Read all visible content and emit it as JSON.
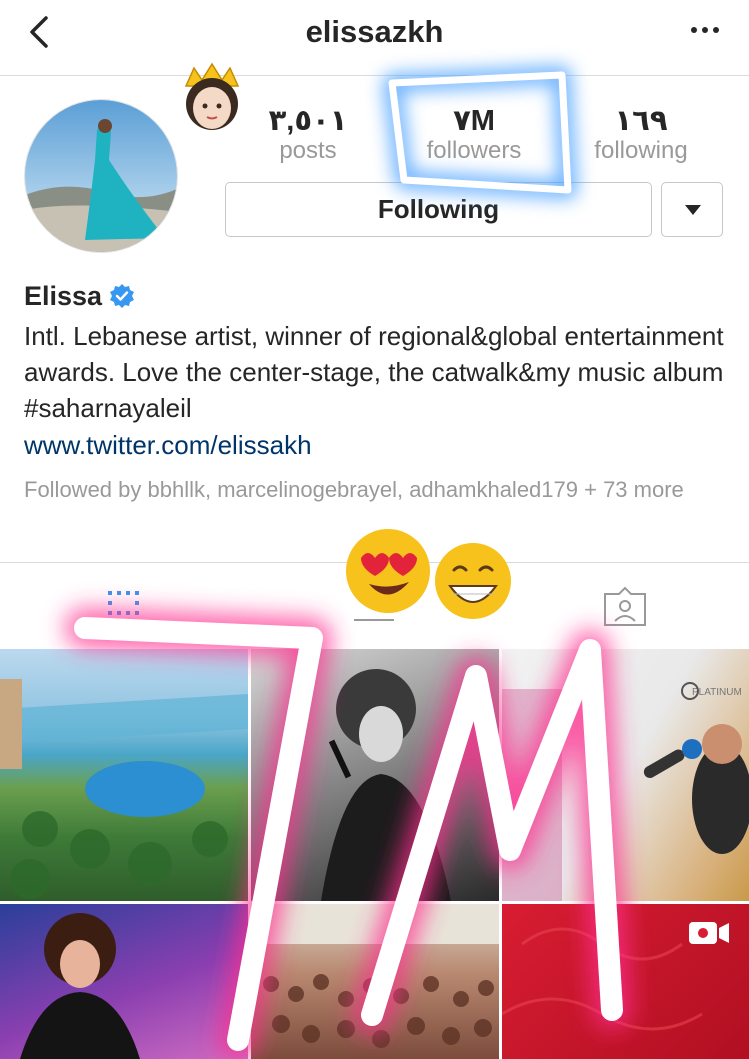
{
  "header": {
    "username": "elissazkh",
    "back_icon": "chevron-left-icon",
    "more_icon": "more-horizontal-icon"
  },
  "stats": {
    "posts": {
      "value": "٣,٥٠١",
      "label": "posts"
    },
    "followers": {
      "value": "٧M",
      "label": "followers"
    },
    "following": {
      "value": "١٦٩",
      "label": "following"
    }
  },
  "actions": {
    "following_label": "Following",
    "dropdown_icon": "caret-down-icon"
  },
  "profile": {
    "name": "Elissa",
    "bio": "Intl. Lebanese artist, winner of regional&global entertainment awards. Love the center-stage, the catwalk&my music album #saharnayaleil",
    "link": "www.twitter.com/elissakh",
    "followed_by": "Followed by bbhllk, marcelinogebrayel, adhamkhaled179 + 73 more"
  },
  "tabs": [
    "grid-view-icon",
    "list-view-icon",
    "tagged-icon"
  ],
  "overlay": {
    "handwritten": "7M",
    "emojis": [
      "crown-emoji",
      "heart-eyes-emoji",
      "grinning-emoji"
    ]
  },
  "colors": {
    "accent_link": "#003569",
    "verified": "#3897f0",
    "glow_blue": "#4da3ff",
    "glow_pink": "#ff2f8f"
  }
}
